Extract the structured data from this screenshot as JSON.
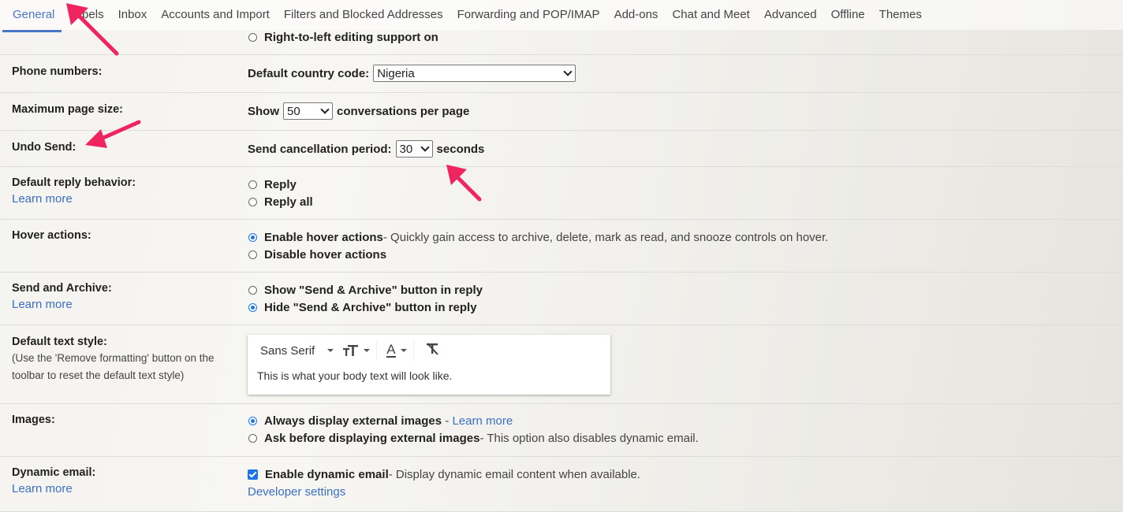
{
  "tabs": [
    {
      "label": "General",
      "active": true
    },
    {
      "label": "Labels"
    },
    {
      "label": "Inbox"
    },
    {
      "label": "Accounts and Import"
    },
    {
      "label": "Filters and Blocked Addresses"
    },
    {
      "label": "Forwarding and POP/IMAP"
    },
    {
      "label": "Add-ons"
    },
    {
      "label": "Chat and Meet"
    },
    {
      "label": "Advanced"
    },
    {
      "label": "Offline"
    },
    {
      "label": "Themes"
    }
  ],
  "rtl": {
    "label": "Right-to-left editing support on"
  },
  "phone": {
    "label": "Phone numbers:",
    "field_label": "Default country code:",
    "value": "Nigeria"
  },
  "page_size": {
    "label": "Maximum page size:",
    "prefix": "Show",
    "value": "50",
    "suffix": "conversations per page"
  },
  "undo_send": {
    "label": "Undo Send:",
    "field_label": "Send cancellation period:",
    "value": "30",
    "suffix": "seconds"
  },
  "reply": {
    "label": "Default reply behavior:",
    "learn_more": "Learn more",
    "options": [
      "Reply",
      "Reply all"
    ]
  },
  "hover": {
    "label": "Hover actions:",
    "opt1": "Enable hover actions",
    "opt1_desc": " - Quickly gain access to archive, delete, mark as read, and snooze controls on hover.",
    "opt2": "Disable hover actions"
  },
  "send_archive": {
    "label": "Send and Archive:",
    "learn_more": "Learn more",
    "opt1": "Show \"Send & Archive\" button in reply",
    "opt2": "Hide \"Send & Archive\" button in reply"
  },
  "text_style": {
    "label": "Default text style:",
    "hint": "(Use the 'Remove formatting' button on the toolbar to reset the default text style)",
    "font": "Sans Serif",
    "text_color_glyph": "A",
    "preview": "This is what your body text will look like."
  },
  "images": {
    "label": "Images:",
    "opt1": "Always display external images",
    "opt1_sep": " - ",
    "opt1_link": "Learn more",
    "opt2": "Ask before displaying external images",
    "opt2_desc": " - This option also disables dynamic email."
  },
  "dynamic": {
    "label": "Dynamic email:",
    "learn_more": "Learn more",
    "opt": "Enable dynamic email",
    "opt_desc": " - Display dynamic email content when available.",
    "dev_link": "Developer settings"
  },
  "annotation_color": "#f0245f"
}
